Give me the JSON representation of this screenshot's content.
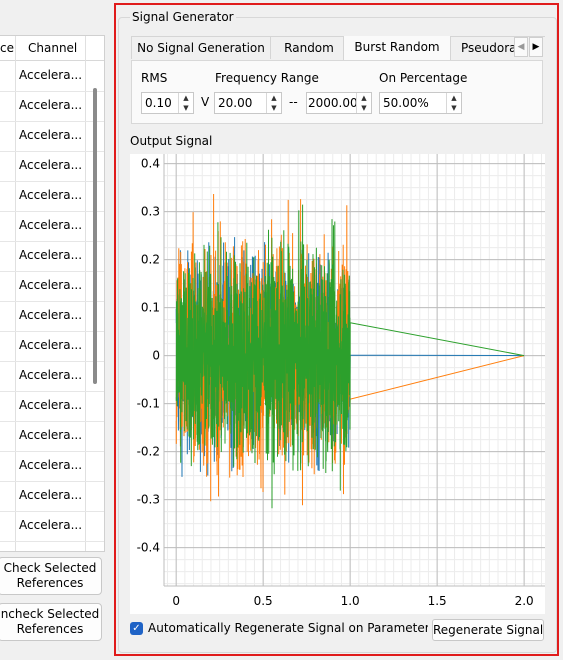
{
  "left_table": {
    "headers": [
      "ce",
      "Channel"
    ],
    "rows": [
      "Accelera...",
      "Accelera...",
      "Accelera...",
      "Accelera...",
      "Accelera...",
      "Accelera...",
      "Accelera...",
      "Accelera...",
      "Accelera...",
      "Accelera...",
      "Accelera...",
      "Accelera...",
      "Accelera...",
      "Accelera...",
      "Accelera...",
      "Accelera..."
    ],
    "check_button": [
      "Check Selected",
      "References"
    ],
    "uncheck_button": [
      "ncheck Selected",
      "References"
    ]
  },
  "signal_generator": {
    "title": "Signal Generator",
    "tabs": [
      "No Signal Generation",
      "Random",
      "Burst Random",
      "Pseudora"
    ],
    "active_tab": "Burst Random",
    "rms": {
      "label": "RMS",
      "value": "0.10",
      "unit": "V"
    },
    "frequency_range": {
      "label": "Frequency Range",
      "low": "20.00",
      "separator": "--",
      "high": "2000.00"
    },
    "on_percentage": {
      "label": "On Percentage",
      "value": "50.00%"
    },
    "output_title": "Output Signal",
    "auto_regen_label": "Automatically Regenerate Signal on Parameter C",
    "auto_regen_checked": true,
    "regen_button": "Regenerate Signal"
  },
  "chart_data": {
    "type": "line",
    "xlim": [
      -0.07,
      2.12
    ],
    "ylim": [
      -0.48,
      0.42
    ],
    "x_ticks": [
      0,
      0.5,
      1.0,
      1.5,
      2.0
    ],
    "x_tick_labels": [
      "0",
      "0.5",
      "1.0",
      "1.5",
      "2.0"
    ],
    "y_ticks": [
      -0.4,
      -0.3,
      -0.2,
      -0.1,
      0,
      0.1,
      0.2,
      0.3,
      0.4
    ],
    "y_tick_labels": [
      "-0.4",
      "-0.3",
      "-0.2",
      "-0.1",
      "0",
      "0.1",
      "0.2",
      "0.3",
      "0.4"
    ],
    "grid": true,
    "burst_end": 1.0,
    "x_end": 2.0,
    "series": [
      {
        "color": "#1f77b4",
        "amplitude": 0.3
      },
      {
        "color": "#ff7f0e",
        "amplitude": 0.36
      },
      {
        "color": "#2ca02c",
        "amplitude": 0.33
      }
    ]
  }
}
